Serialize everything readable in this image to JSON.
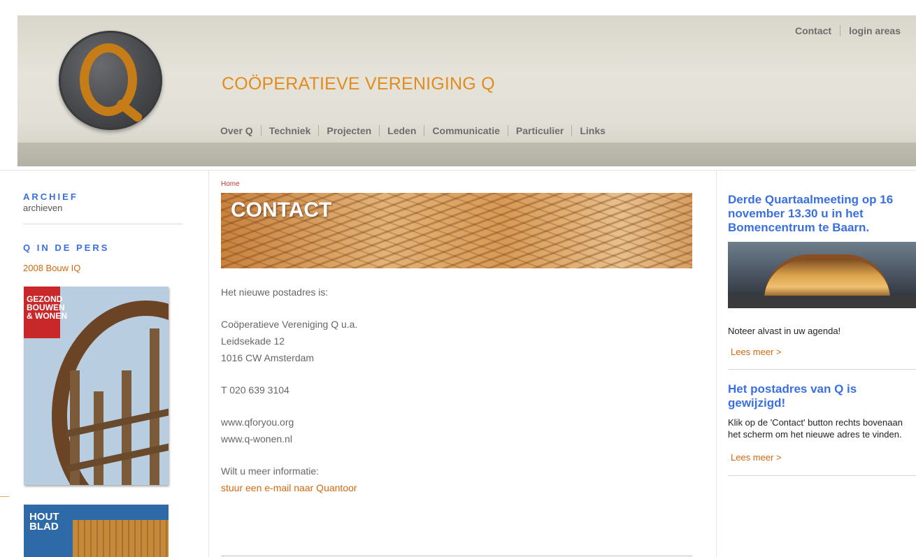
{
  "header": {
    "site_title": "COÖPERATIEVE VERENIGING Q",
    "nav": [
      "Over Q",
      "Techniek",
      "Projecten",
      "Leden",
      "Communicatie",
      "Particulier",
      "Links"
    ],
    "top_links": [
      "Contact",
      "login areas"
    ]
  },
  "left": {
    "archief_title": "ARCHIEF",
    "archief_sub": "archieven",
    "pers_title": "Q IN DE PERS",
    "pers_link": "2008 Bouw IQ",
    "mag1_title_lines": [
      "GEZOND",
      "BOUWEN",
      "& WONEN"
    ],
    "mag2_title_lines": [
      "HOUT",
      "BLAD"
    ]
  },
  "main": {
    "breadcrumb": "Home",
    "banner_title": "CONTACT",
    "intro": "Het nieuwe postadres is:",
    "address": [
      "Coöperatieve Vereniging Q u.a.",
      "Leidsekade 12",
      "1016 CW Amsterdam"
    ],
    "phone": "T 020 639 3104",
    "websites": [
      "www.qforyou.org",
      "www.q-wonen.nl"
    ],
    "info_label": "Wilt u meer informatie:",
    "email_link": "stuur een e-mail naar Quantoor"
  },
  "right": {
    "news": [
      {
        "title": "Derde Quartaalmeeting op 16 november 13.30 u in het Bomencentrum te Baarn.",
        "text": "Noteer alvast in uw agenda!",
        "more": "Lees meer >"
      },
      {
        "title": "Het postadres van Q is gewijzigd!",
        "text": "Klik op de 'Contact' button rechts bovenaan het scherm om het nieuwe adres te vinden.",
        "more": "Lees meer >"
      }
    ]
  },
  "colors": {
    "accent_orange": "#d2690f",
    "title_orange": "#e08c1e",
    "heading_blue": "#3a6fe0"
  }
}
